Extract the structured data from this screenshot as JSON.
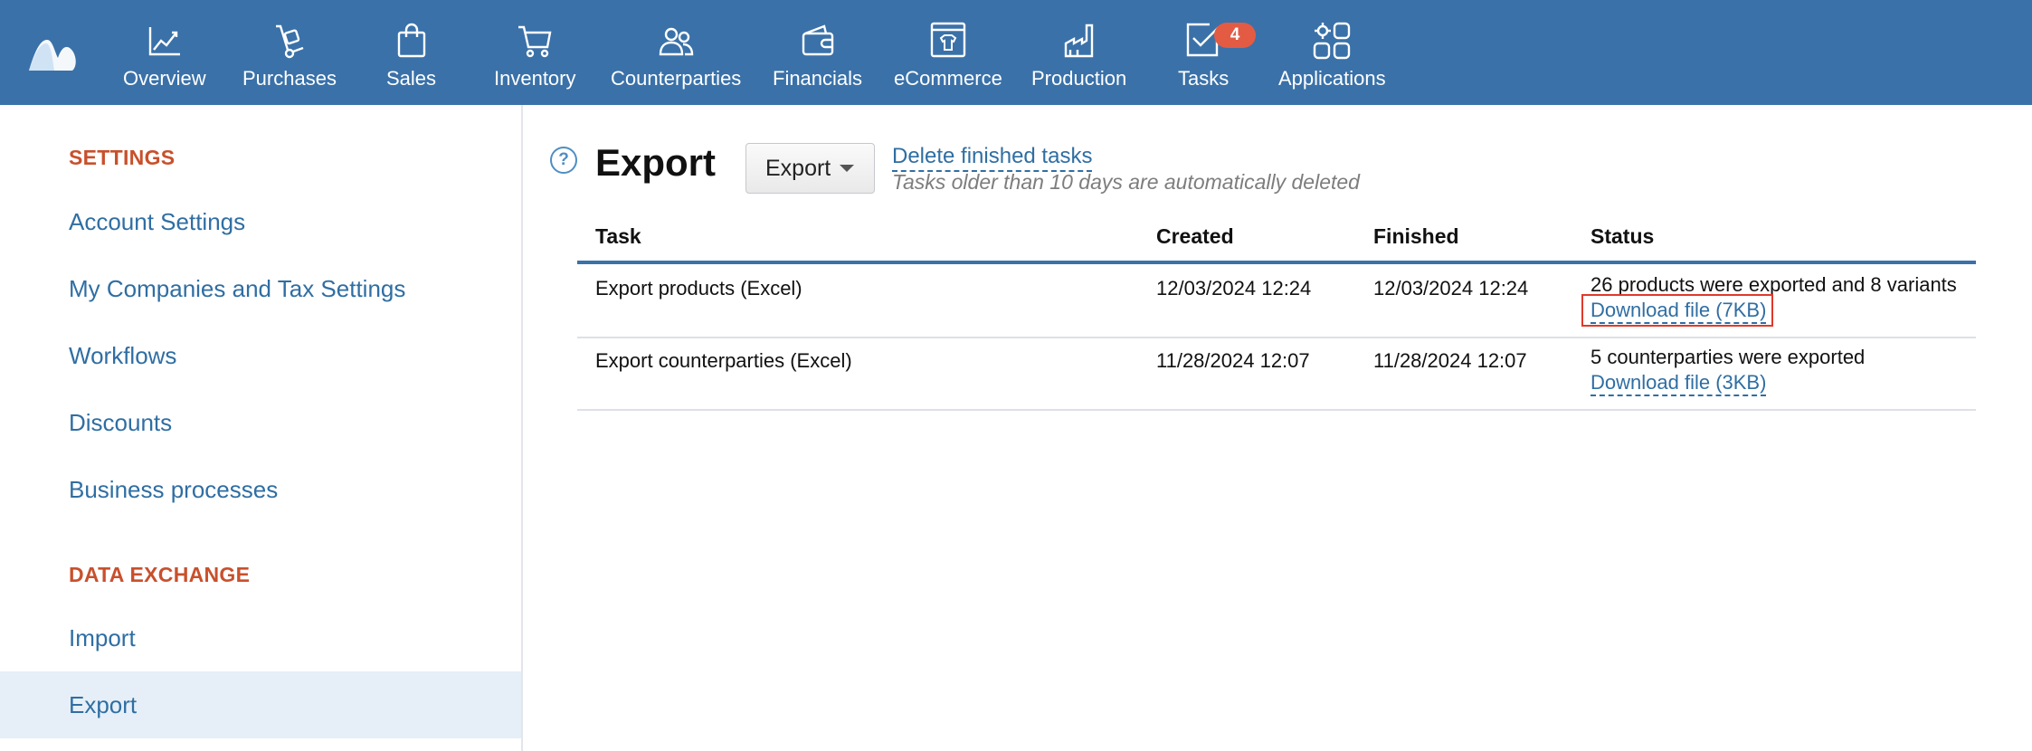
{
  "nav": {
    "items": [
      {
        "label": "Overview",
        "icon": "chart-line-icon"
      },
      {
        "label": "Purchases",
        "icon": "hand-truck-icon"
      },
      {
        "label": "Sales",
        "icon": "shopping-bag-icon"
      },
      {
        "label": "Inventory",
        "icon": "shopping-cart-icon"
      },
      {
        "label": "Counterparties",
        "icon": "people-icon"
      },
      {
        "label": "Financials",
        "icon": "wallet-icon"
      },
      {
        "label": "eCommerce",
        "icon": "storefront-icon"
      },
      {
        "label": "Production",
        "icon": "factory-icon"
      },
      {
        "label": "Tasks",
        "icon": "task-check-icon",
        "badge": "4"
      },
      {
        "label": "Applications",
        "icon": "apps-grid-icon"
      }
    ],
    "badge_color": "#e35b43",
    "bar_color": "#3a71a8"
  },
  "sidebar": {
    "section_settings": "SETTINGS",
    "items": [
      {
        "label": "Account Settings"
      },
      {
        "label": "My Companies and Tax Settings"
      },
      {
        "label": "Workflows"
      },
      {
        "label": "Discounts"
      },
      {
        "label": "Business processes"
      }
    ],
    "section_data_exchange": "DATA EXCHANGE",
    "data_items": [
      {
        "label": "Import"
      },
      {
        "label": "Export",
        "active": true
      }
    ]
  },
  "main": {
    "title": "Export",
    "export_button_label": "Export",
    "delete_link": "Delete finished tasks",
    "note": "Tasks older than 10 days are automatically deleted",
    "columns": {
      "task": "Task",
      "created": "Created",
      "finished": "Finished",
      "status": "Status"
    },
    "rows": [
      {
        "task": "Export products (Excel)",
        "created": "12/03/2024 12:24",
        "finished": "12/03/2024 12:24",
        "status": "26 products were exported and 8 variants",
        "download": "Download file (7KB)",
        "highlighted": true
      },
      {
        "task": "Export counterparties (Excel)",
        "created": "11/28/2024 12:07",
        "finished": "11/28/2024 12:07",
        "status": "5 counterparties were exported",
        "download": "Download file (3KB)"
      }
    ]
  }
}
